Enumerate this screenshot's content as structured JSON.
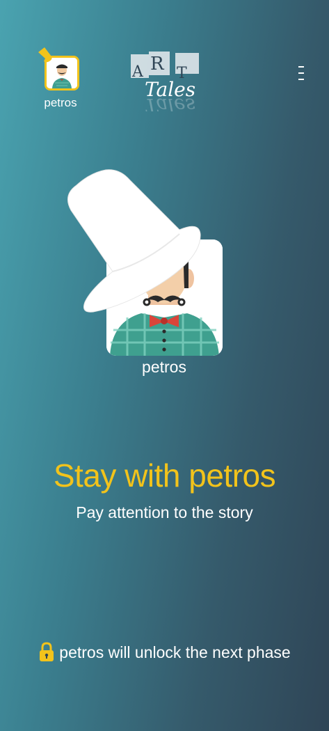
{
  "header": {
    "player_name": "petros",
    "logo_letters": [
      "A",
      "R",
      "T"
    ],
    "logo_word": "Tales",
    "menu_icon": "vertical-dots-icon"
  },
  "main": {
    "avatar_name": "petros",
    "title": "Stay with petros",
    "subtitle": "Pay attention to the story"
  },
  "footer": {
    "lock_icon": "lock-icon",
    "message": "petros will unlock the next phase"
  },
  "colors": {
    "accent": "#f2c31b",
    "background_left": "#4aa3b0",
    "background_right": "#2f4556",
    "text": "#ffffff"
  }
}
